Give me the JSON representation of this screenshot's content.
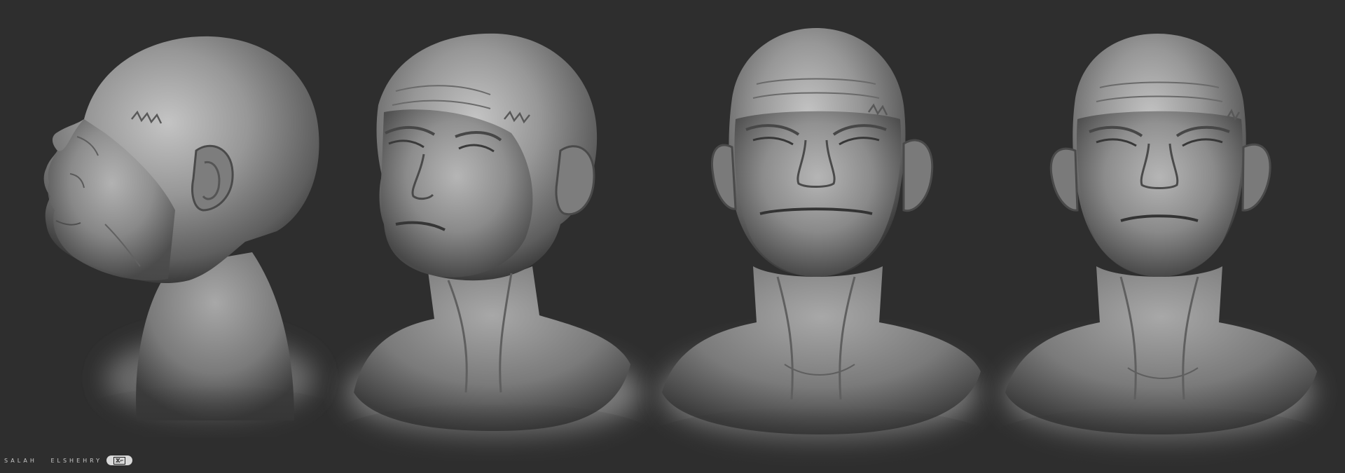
{
  "scene": {
    "background_color": "#2e2e2e",
    "clay_color": "#8a8a8a",
    "description_views": [
      "profile",
      "three-quarter",
      "front-slight",
      "front"
    ]
  },
  "signature": {
    "name": "SALAH   ELSHEHRY",
    "badge_logo": "badge-logo"
  }
}
